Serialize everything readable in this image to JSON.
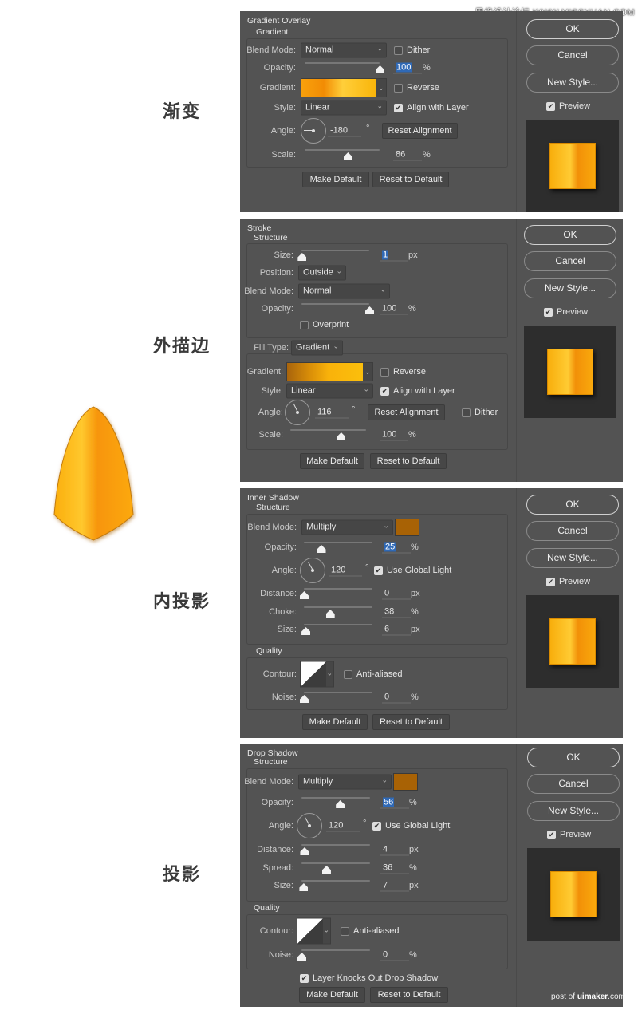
{
  "watermark_top": "思缘设计论坛  WWW.MISSYUAN.COM",
  "watermark_bottom": {
    "prefix": "post of ",
    "brand": "uimaker",
    "suffix": ".com"
  },
  "captions": [
    "渐变",
    "外描边",
    "内投影",
    "投影"
  ],
  "colors": {
    "panel_bg": "#535353",
    "highlight": "#2f69b6",
    "shadow_color": "#a86205",
    "gold": "#f9a80c"
  },
  "common": {
    "ok": "OK",
    "cancel": "Cancel",
    "new_style": "New Style...",
    "preview": "Preview",
    "preview_checked": true,
    "make_default": "Make Default",
    "reset_default": "Reset to Default"
  },
  "panels": [
    {
      "title": "Gradient Overlay",
      "rows": [
        {
          "type": "heading",
          "label": "Gradient"
        },
        {
          "type": "select",
          "label": "Blend Mode:",
          "value": "Normal",
          "checkbox": {
            "label": "Dither",
            "checked": false
          }
        },
        {
          "type": "slider",
          "label": "Opacity:",
          "value": "100",
          "unit": "%",
          "selected": true
        },
        {
          "type": "gradient",
          "label": "Gradient:",
          "colors": [
            "#f9a10c",
            "#f28c04",
            "#ffcf3a",
            "#f9b409"
          ],
          "checkbox": {
            "label": "Reverse",
            "checked": false
          }
        },
        {
          "type": "select",
          "label": "Style:",
          "value": "Linear",
          "checkbox": {
            "label": "Align with Layer",
            "checked": true
          }
        },
        {
          "type": "angle",
          "label": "Angle:",
          "value": "-180",
          "unit": "°",
          "button": "Reset Alignment"
        },
        {
          "type": "slider",
          "label": "Scale:",
          "value": "86",
          "unit": "%"
        }
      ]
    },
    {
      "title": "Stroke",
      "rows": [
        {
          "type": "heading",
          "label": "Structure"
        },
        {
          "type": "slider",
          "label": "Size:",
          "value": "1",
          "unit": "px",
          "selected": true
        },
        {
          "type": "select",
          "label": "Position:",
          "value": "Outside"
        },
        {
          "type": "select",
          "label": "Blend Mode:",
          "value": "Normal"
        },
        {
          "type": "slider",
          "label": "Opacity:",
          "value": "100",
          "unit": "%"
        },
        {
          "type": "checkbox",
          "label": "Overprint",
          "checked": false
        },
        {
          "type": "select",
          "label": "Fill Type:",
          "value": "Gradient"
        },
        {
          "type": "gradient",
          "label": "Gradient:",
          "colors": [
            "#a8640c",
            "#d98e08",
            "#f9b20a",
            "#fbbf0c"
          ],
          "checkbox": {
            "label": "Reverse",
            "checked": false
          }
        },
        {
          "type": "select",
          "label": "Style:",
          "value": "Linear",
          "checkbox": {
            "label": "Align with Layer",
            "checked": true
          }
        },
        {
          "type": "angle",
          "label": "Angle:",
          "value": "116",
          "unit": "°",
          "button": "Reset Alignment",
          "checkbox": {
            "label": "Dither",
            "checked": false
          }
        },
        {
          "type": "slider",
          "label": "Scale:",
          "value": "100",
          "unit": "%"
        }
      ]
    },
    {
      "title": "Inner Shadow",
      "rows": [
        {
          "type": "heading",
          "label": "Structure"
        },
        {
          "type": "select",
          "label": "Blend Mode:",
          "value": "Multiply",
          "swatch": "#a86205"
        },
        {
          "type": "slider",
          "label": "Opacity:",
          "value": "25",
          "unit": "%",
          "selected": true
        },
        {
          "type": "angle",
          "label": "Angle:",
          "value": "120",
          "unit": "°",
          "checkbox": {
            "label": "Use Global Light",
            "checked": true
          }
        },
        {
          "type": "slider",
          "label": "Distance:",
          "value": "0",
          "unit": "px"
        },
        {
          "type": "slider",
          "label": "Choke:",
          "value": "38",
          "unit": "%"
        },
        {
          "type": "slider",
          "label": "Size:",
          "value": "6",
          "unit": "px"
        },
        {
          "type": "heading",
          "label": "Quality"
        },
        {
          "type": "contour",
          "label": "Contour:",
          "checkbox": {
            "label": "Anti-aliased",
            "checked": false
          }
        },
        {
          "type": "slider",
          "label": "Noise:",
          "value": "0",
          "unit": "%"
        }
      ]
    },
    {
      "title": "Drop Shadow",
      "rows": [
        {
          "type": "heading",
          "label": "Structure"
        },
        {
          "type": "select",
          "label": "Blend Mode:",
          "value": "Multiply",
          "swatch": "#a86205"
        },
        {
          "type": "slider",
          "label": "Opacity:",
          "value": "56",
          "unit": "%",
          "selected": true
        },
        {
          "type": "angle",
          "label": "Angle:",
          "value": "120",
          "unit": "°",
          "checkbox": {
            "label": "Use Global Light",
            "checked": true
          }
        },
        {
          "type": "slider",
          "label": "Distance:",
          "value": "4",
          "unit": "px"
        },
        {
          "type": "slider",
          "label": "Spread:",
          "value": "36",
          "unit": "%"
        },
        {
          "type": "slider",
          "label": "Size:",
          "value": "7",
          "unit": "px"
        },
        {
          "type": "heading",
          "label": "Quality"
        },
        {
          "type": "contour",
          "label": "Contour:",
          "checkbox": {
            "label": "Anti-aliased",
            "checked": false
          }
        },
        {
          "type": "slider",
          "label": "Noise:",
          "value": "0",
          "unit": "%"
        },
        {
          "type": "checkbox",
          "label": "Layer Knocks Out Drop Shadow",
          "checked": true
        }
      ]
    }
  ]
}
